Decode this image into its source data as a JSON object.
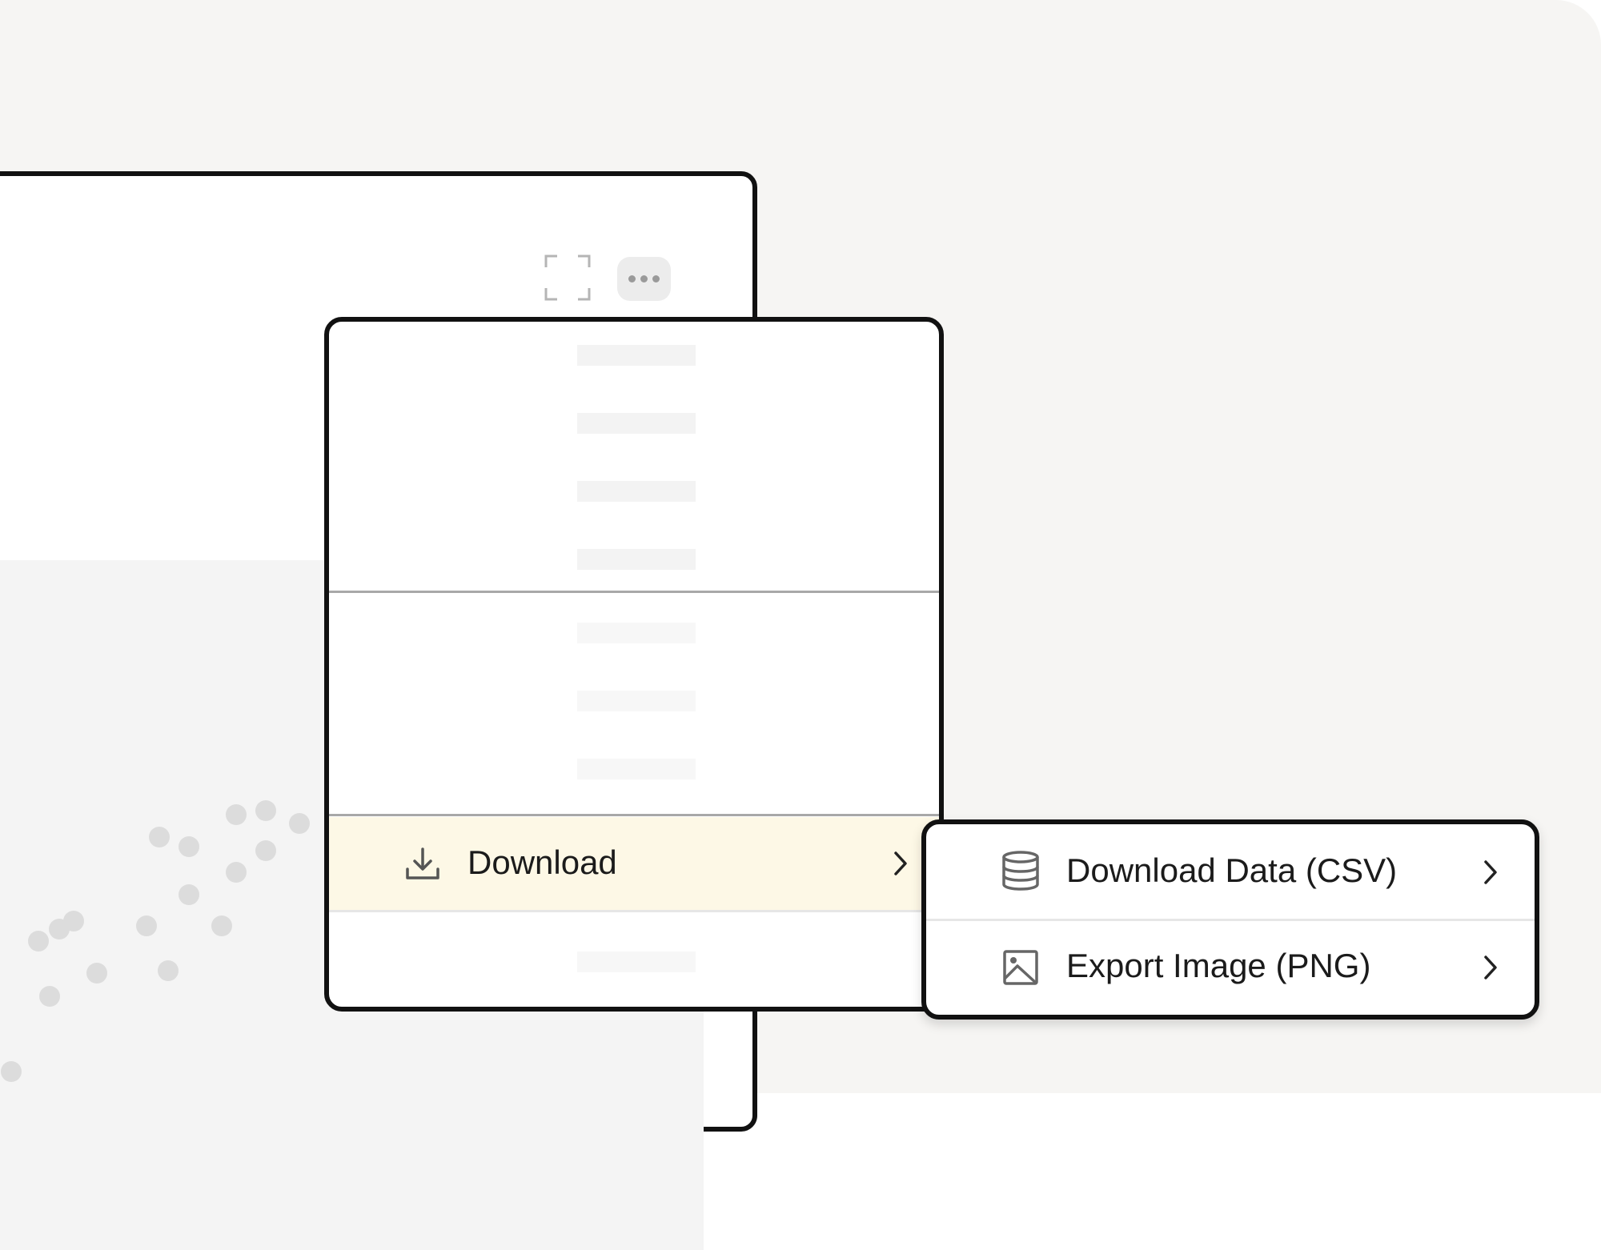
{
  "menu": {
    "download_label": "Download",
    "download_icon": "download-icon",
    "chevron_icon": "chevron-right-icon"
  },
  "submenu": {
    "items": [
      {
        "label": "Download Data (CSV)",
        "icon": "database-icon"
      },
      {
        "label": "Export Image (PNG)",
        "icon": "image-icon"
      }
    ]
  },
  "toolbar": {
    "fullscreen_icon": "fullscreen-icon",
    "more_icon": "more-horizontal-icon"
  },
  "colors": {
    "highlight": "#fdf8e6",
    "border": "#111111",
    "placeholder": "#f3f3f3",
    "dot": "#dcdcdc"
  }
}
